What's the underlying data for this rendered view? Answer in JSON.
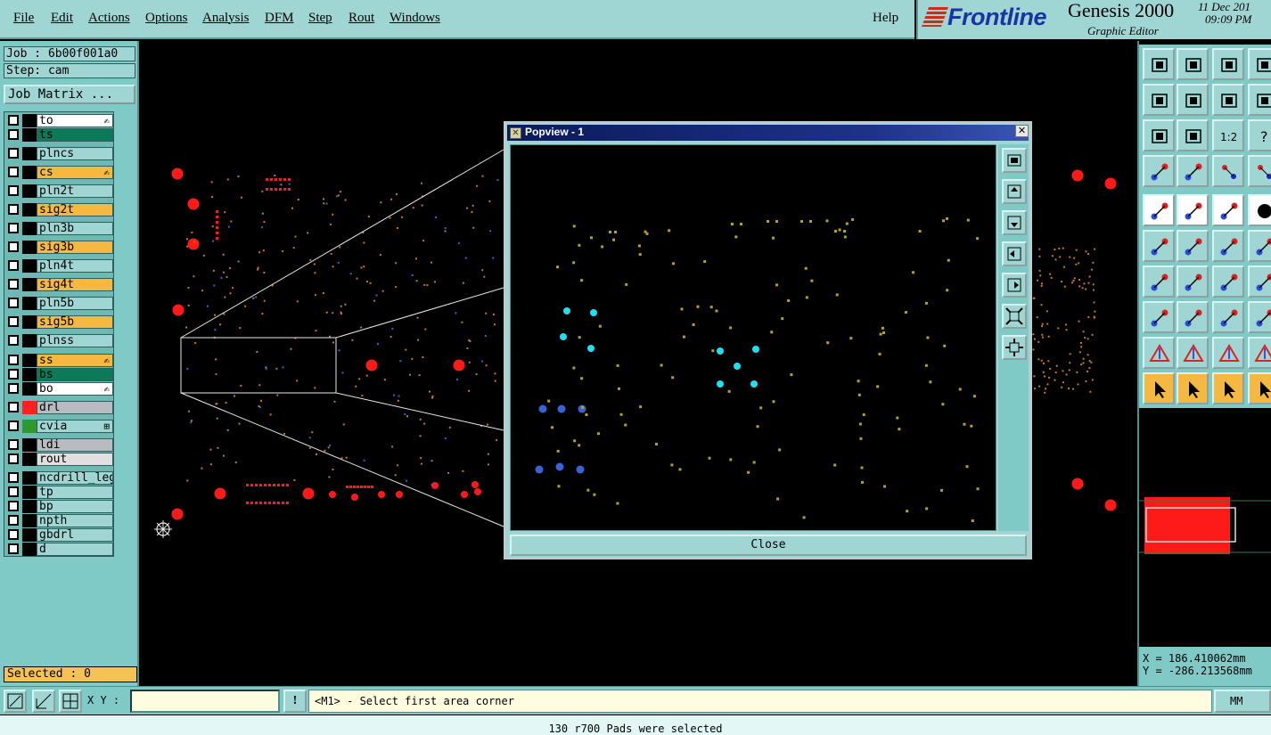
{
  "menubar": {
    "items": [
      "File",
      "Edit",
      "Actions",
      "Options",
      "Analysis",
      "DFM",
      "Step",
      "Rout",
      "Windows"
    ],
    "help": "Help"
  },
  "brand": {
    "logo": "Frontline",
    "product": "Genesis 2000",
    "subtitle": "Graphic Editor",
    "date": "11 Dec 201",
    "time": "09:09 PM"
  },
  "left": {
    "job": "Job : 6b00f001a0",
    "step": "Step: cam",
    "job_matrix": "Job Matrix ...",
    "selected": "Selected : 0",
    "layers": [
      {
        "name": "to",
        "bg": "#ffffff",
        "swatch": "#000000",
        "mark": "✍"
      },
      {
        "name": "ts",
        "bg": "#0c7a58",
        "swatch": "#000000",
        "mark": ""
      },
      {
        "name": "plncs",
        "bg": "#9fd6d3",
        "swatch": "#000000",
        "mark": ""
      },
      {
        "name": "cs",
        "bg": "#f5b942",
        "swatch": "#000000",
        "mark": "✍"
      },
      {
        "name": "pln2t",
        "bg": "#9fd6d3",
        "swatch": "#000000",
        "mark": ""
      },
      {
        "name": "sig2t",
        "bg": "#f5b942",
        "swatch": "#000000",
        "mark": ""
      },
      {
        "name": "pln3b",
        "bg": "#9fd6d3",
        "swatch": "#000000",
        "mark": ""
      },
      {
        "name": "sig3b",
        "bg": "#f5b942",
        "swatch": "#000000",
        "mark": ""
      },
      {
        "name": "pln4t",
        "bg": "#9fd6d3",
        "swatch": "#000000",
        "mark": ""
      },
      {
        "name": "sig4t",
        "bg": "#f5b942",
        "swatch": "#000000",
        "mark": ""
      },
      {
        "name": "pln5b",
        "bg": "#9fd6d3",
        "swatch": "#000000",
        "mark": ""
      },
      {
        "name": "sig5b",
        "bg": "#f5b942",
        "swatch": "#000000",
        "mark": ""
      },
      {
        "name": "plnss",
        "bg": "#9fd6d3",
        "swatch": "#000000",
        "mark": ""
      },
      {
        "name": "ss",
        "bg": "#f5b942",
        "swatch": "#000000",
        "mark": "✍"
      },
      {
        "name": "bs",
        "bg": "#0c7a58",
        "swatch": "#000000",
        "mark": ""
      },
      {
        "name": "bo",
        "bg": "#ffffff",
        "swatch": "#000000",
        "mark": "✍"
      },
      {
        "name": "drl",
        "bg": "#b8bcc0",
        "swatch": "#ff2020",
        "mark": ""
      },
      {
        "name": "cvia",
        "bg": "#9fd6d3",
        "swatch": "#2e9a2e",
        "mark": "⊞"
      },
      {
        "name": "ldi",
        "bg": "#b8bcc0",
        "swatch": "#000000",
        "mark": ""
      },
      {
        "name": "rout",
        "bg": "#e0e0e0",
        "swatch": "#000000",
        "mark": ""
      },
      {
        "name": "ncdrill_lege",
        "bg": "#9fd6d3",
        "swatch": "#000000",
        "mark": ""
      },
      {
        "name": "tp",
        "bg": "#9fd6d3",
        "swatch": "#000000",
        "mark": ""
      },
      {
        "name": "bp",
        "bg": "#9fd6d3",
        "swatch": "#000000",
        "mark": ""
      },
      {
        "name": "npth",
        "bg": "#9fd6d3",
        "swatch": "#000000",
        "mark": ""
      },
      {
        "name": "gbdrl",
        "bg": "#9fd6d3",
        "swatch": "#000000",
        "mark": ""
      },
      {
        "name": "d",
        "bg": "#9fd6d3",
        "swatch": "#000000",
        "mark": ""
      }
    ]
  },
  "popview": {
    "title": "Popview - 1",
    "close_x": "✕",
    "close_label": "Close"
  },
  "coords": {
    "x": "X = 186.410062mm",
    "y": "Y = -286.213568mm"
  },
  "cmdbar": {
    "xy_label": "X Y :",
    "xy_value": "",
    "info_icon": "!",
    "prompt": "<M1> - Select first area corner",
    "units": "MM"
  },
  "status": "130 r700 Pads were selected",
  "colors": {
    "panel": "#7fcac6",
    "panel_light": "#9fd6d3",
    "pad_red": "#ff1a1a",
    "trace_orange": "#c8782a",
    "pad_olive": "#b8a020",
    "via_cyan": "#1ee0f0",
    "via_blue": "#3a62d8"
  }
}
